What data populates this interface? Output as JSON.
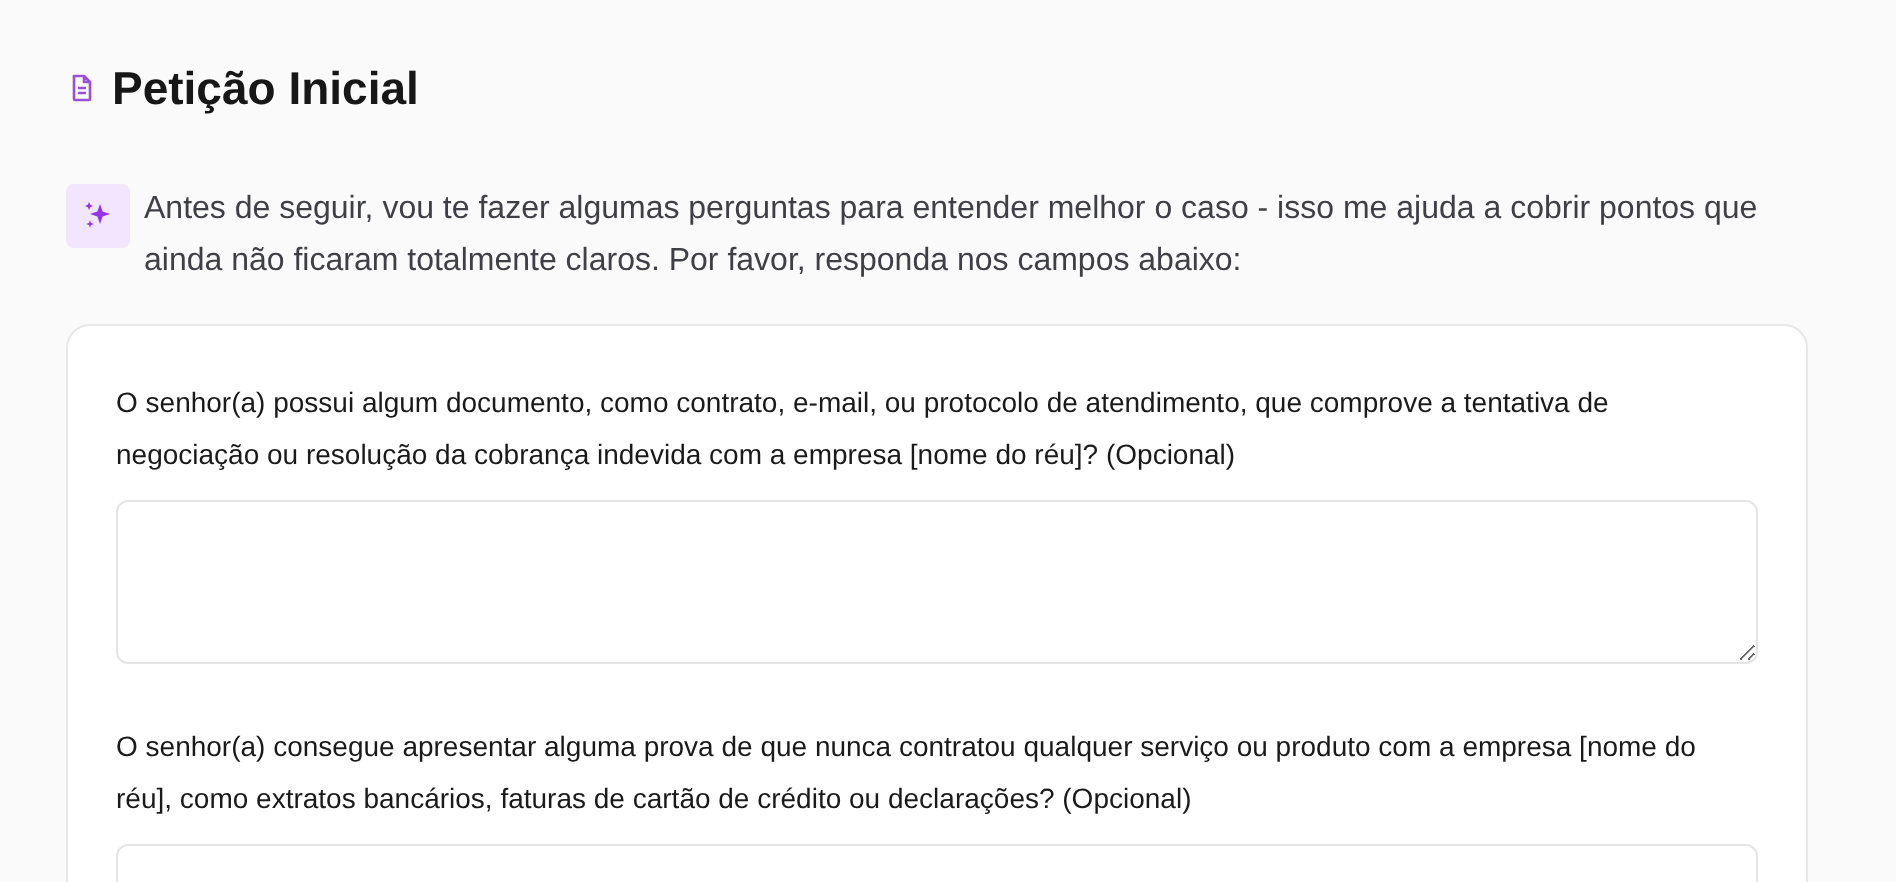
{
  "title": "Petição Inicial",
  "intro": "Antes de seguir, vou te fazer algumas perguntas para entender melhor o caso - isso me ajuda a cobrir pontos que ainda não ficaram totalmente claros. Por favor, responda nos campos abaixo:",
  "questions": [
    {
      "label": "O senhor(a) possui algum documento, como contrato, e-mail, ou protocolo de atendimento, que comprove a tentativa de negociação ou resolução da cobrança indevida com a empresa [nome do réu]? (Opcional)"
    },
    {
      "label": "O senhor(a) consegue apresentar alguma prova de que nunca contratou qualquer serviço ou produto com a empresa [nome do réu], como extratos bancários, faturas de cartão de crédito ou declarações? (Opcional)"
    }
  ]
}
